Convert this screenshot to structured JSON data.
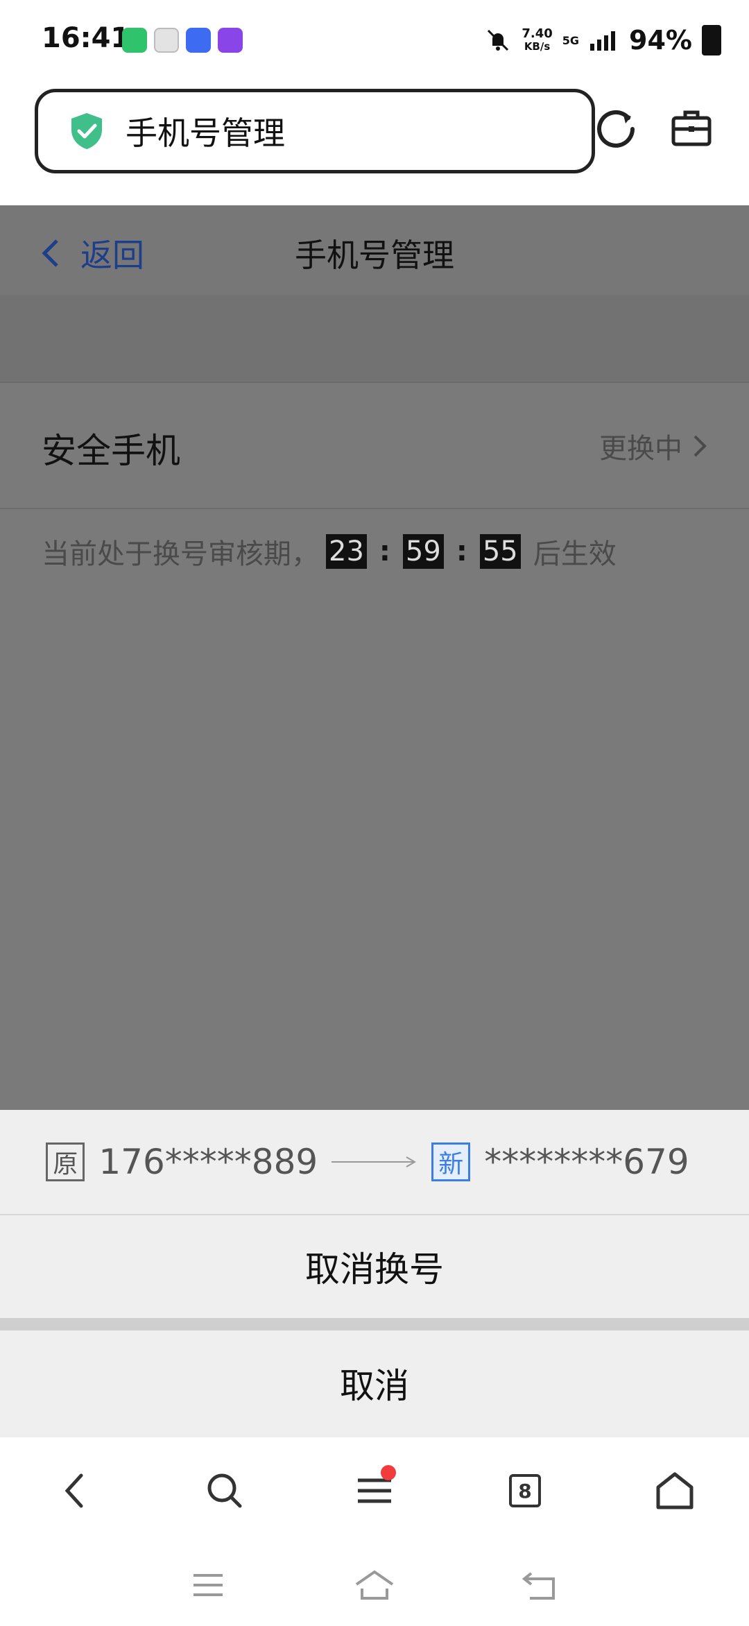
{
  "status_bar": {
    "time": "16:41",
    "net_speed_value": "7.40",
    "net_speed_unit": "KB/s",
    "network": "5G",
    "battery": "94%"
  },
  "browser": {
    "url_title": "手机号管理",
    "security_icon": "shield-check-icon",
    "accent": "#3fbf8a"
  },
  "page": {
    "back_label": "返回",
    "title": "手机号管理",
    "row_label": "安全手机",
    "row_status": "更换中",
    "notice_before": "当前处于换号审核期，",
    "timer_hours": "23",
    "timer_minutes": "59",
    "timer_seconds": "55",
    "timer_sep": ":",
    "notice_after": "后生效"
  },
  "sheet": {
    "old_tag": "原",
    "old_number": "176*****889",
    "new_tag": "新",
    "new_number": "********679",
    "cancel_change_label": "取消换号",
    "cancel_label": "取消"
  },
  "nav": {
    "tab_count": "8"
  }
}
